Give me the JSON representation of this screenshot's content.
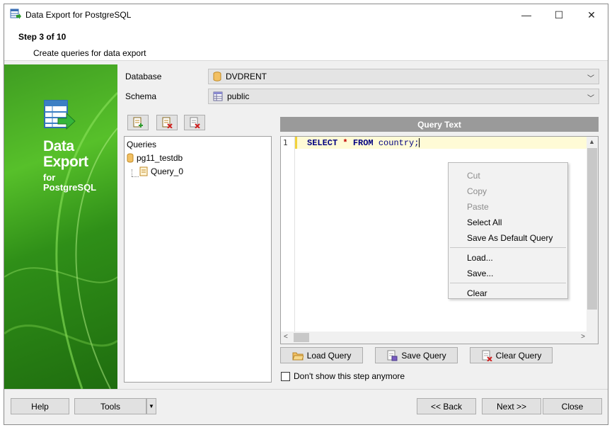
{
  "window": {
    "title": "Data Export for PostgreSQL",
    "controls": {
      "minimize": "—",
      "maximize": "☐",
      "close": "✕"
    }
  },
  "header": {
    "step": "Step 3 of 10",
    "description": "Create queries for data export"
  },
  "banner": {
    "line1": "Data",
    "line2": "Export",
    "line3": "for",
    "line4": "PostgreSQL",
    "colors": {
      "green_light": "#57c02a",
      "green_dark": "#1f6d0f"
    }
  },
  "form": {
    "database_label": "Database",
    "database_value": "DVDRENT",
    "schema_label": "Schema",
    "schema_value": "public"
  },
  "tree": {
    "root": "Queries",
    "db": "pg11_testdb",
    "query": "Query_0"
  },
  "editor": {
    "header": "Query Text",
    "line_number": "1",
    "code": {
      "kw1": "SELECT",
      "star": "*",
      "kw2": "FROM",
      "table": "country;"
    }
  },
  "context_menu": {
    "items": [
      {
        "label": "Cut",
        "enabled": false
      },
      {
        "label": "Copy",
        "enabled": false
      },
      {
        "label": "Paste",
        "enabled": false
      },
      {
        "label": "Select All",
        "enabled": true
      },
      {
        "label": "Save As Default Query",
        "enabled": true
      },
      {
        "label": "Load...",
        "enabled": true
      },
      {
        "label": "Save...",
        "enabled": true
      },
      {
        "label": "Clear",
        "enabled": true
      }
    ]
  },
  "query_buttons": {
    "load": "Load Query",
    "save": "Save Query",
    "clear": "Clear Query"
  },
  "checkbox": {
    "label": "Don't show this step anymore",
    "checked": false
  },
  "footer": {
    "help": "Help",
    "tools": "Tools",
    "back": "<< Back",
    "next": "Next >>",
    "close": "Close"
  }
}
